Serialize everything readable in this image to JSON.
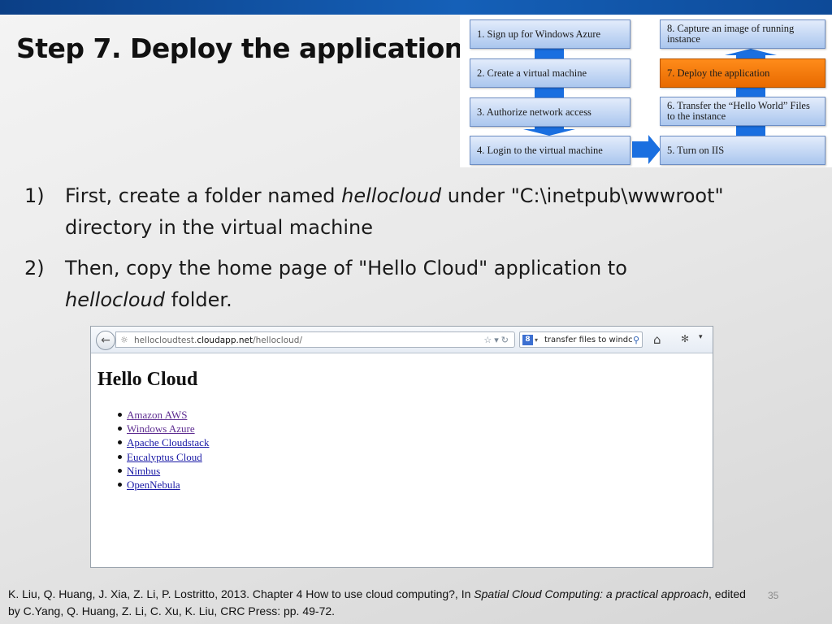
{
  "slide": {
    "title": "Step 7. Deploy the application",
    "page_number": "35"
  },
  "flow": {
    "steps": [
      "1. Sign up for Windows Azure",
      "2. Create a virtual machine",
      "3. Authorize network access",
      "4. Login to the virtual machine",
      "5. Turn on IIS",
      "6. Transfer the “Hello World” Files to the instance",
      "7. Deploy the application",
      "8. Capture an image of running instance"
    ],
    "active_step": 7,
    "colors": {
      "step_fill": "#aac6ee",
      "active_fill": "#f07800",
      "arrow": "#1a6fe0"
    }
  },
  "bullets": [
    {
      "num": "1)",
      "pre": "First, create a folder named ",
      "em": "hellocloud",
      "post": " under \"C:\\inetpub\\wwwroot\" directory in the virtual machine"
    },
    {
      "num": "2)",
      "pre": "Then, copy the home page of \"Hello Cloud\" application to ",
      "em": "hellocloud",
      "post": " folder."
    }
  ],
  "browser": {
    "url_pre": "hellocloudtest.",
    "url_host": "cloudapp.net",
    "url_path": "/hellocloud/",
    "search_value": "transfer files to windc",
    "icons": [
      "back-arrow-icon",
      "globe-icon",
      "star-icon",
      "dropdown-icon",
      "refresh-icon",
      "google-icon",
      "search-icon",
      "home-icon",
      "tool-icon"
    ],
    "page_heading": "Hello Cloud",
    "links": [
      "Amazon AWS",
      "Windows Azure",
      "Apache Cloudstack",
      "Eucalyptus Cloud",
      "Nimbus",
      "OpenNebula"
    ]
  },
  "citation": {
    "pre": "K. Liu, Q. Huang, J. Xia, Z. Li, P. Lostritto, 2013. Chapter 4 How to use cloud computing?, In ",
    "em": "Spatial Cloud Computing: a practical approach",
    "post": ", edited by C.Yang, Q. Huang, Z. Li, C. Xu, K. Liu, CRC Press: pp. 49-72."
  }
}
